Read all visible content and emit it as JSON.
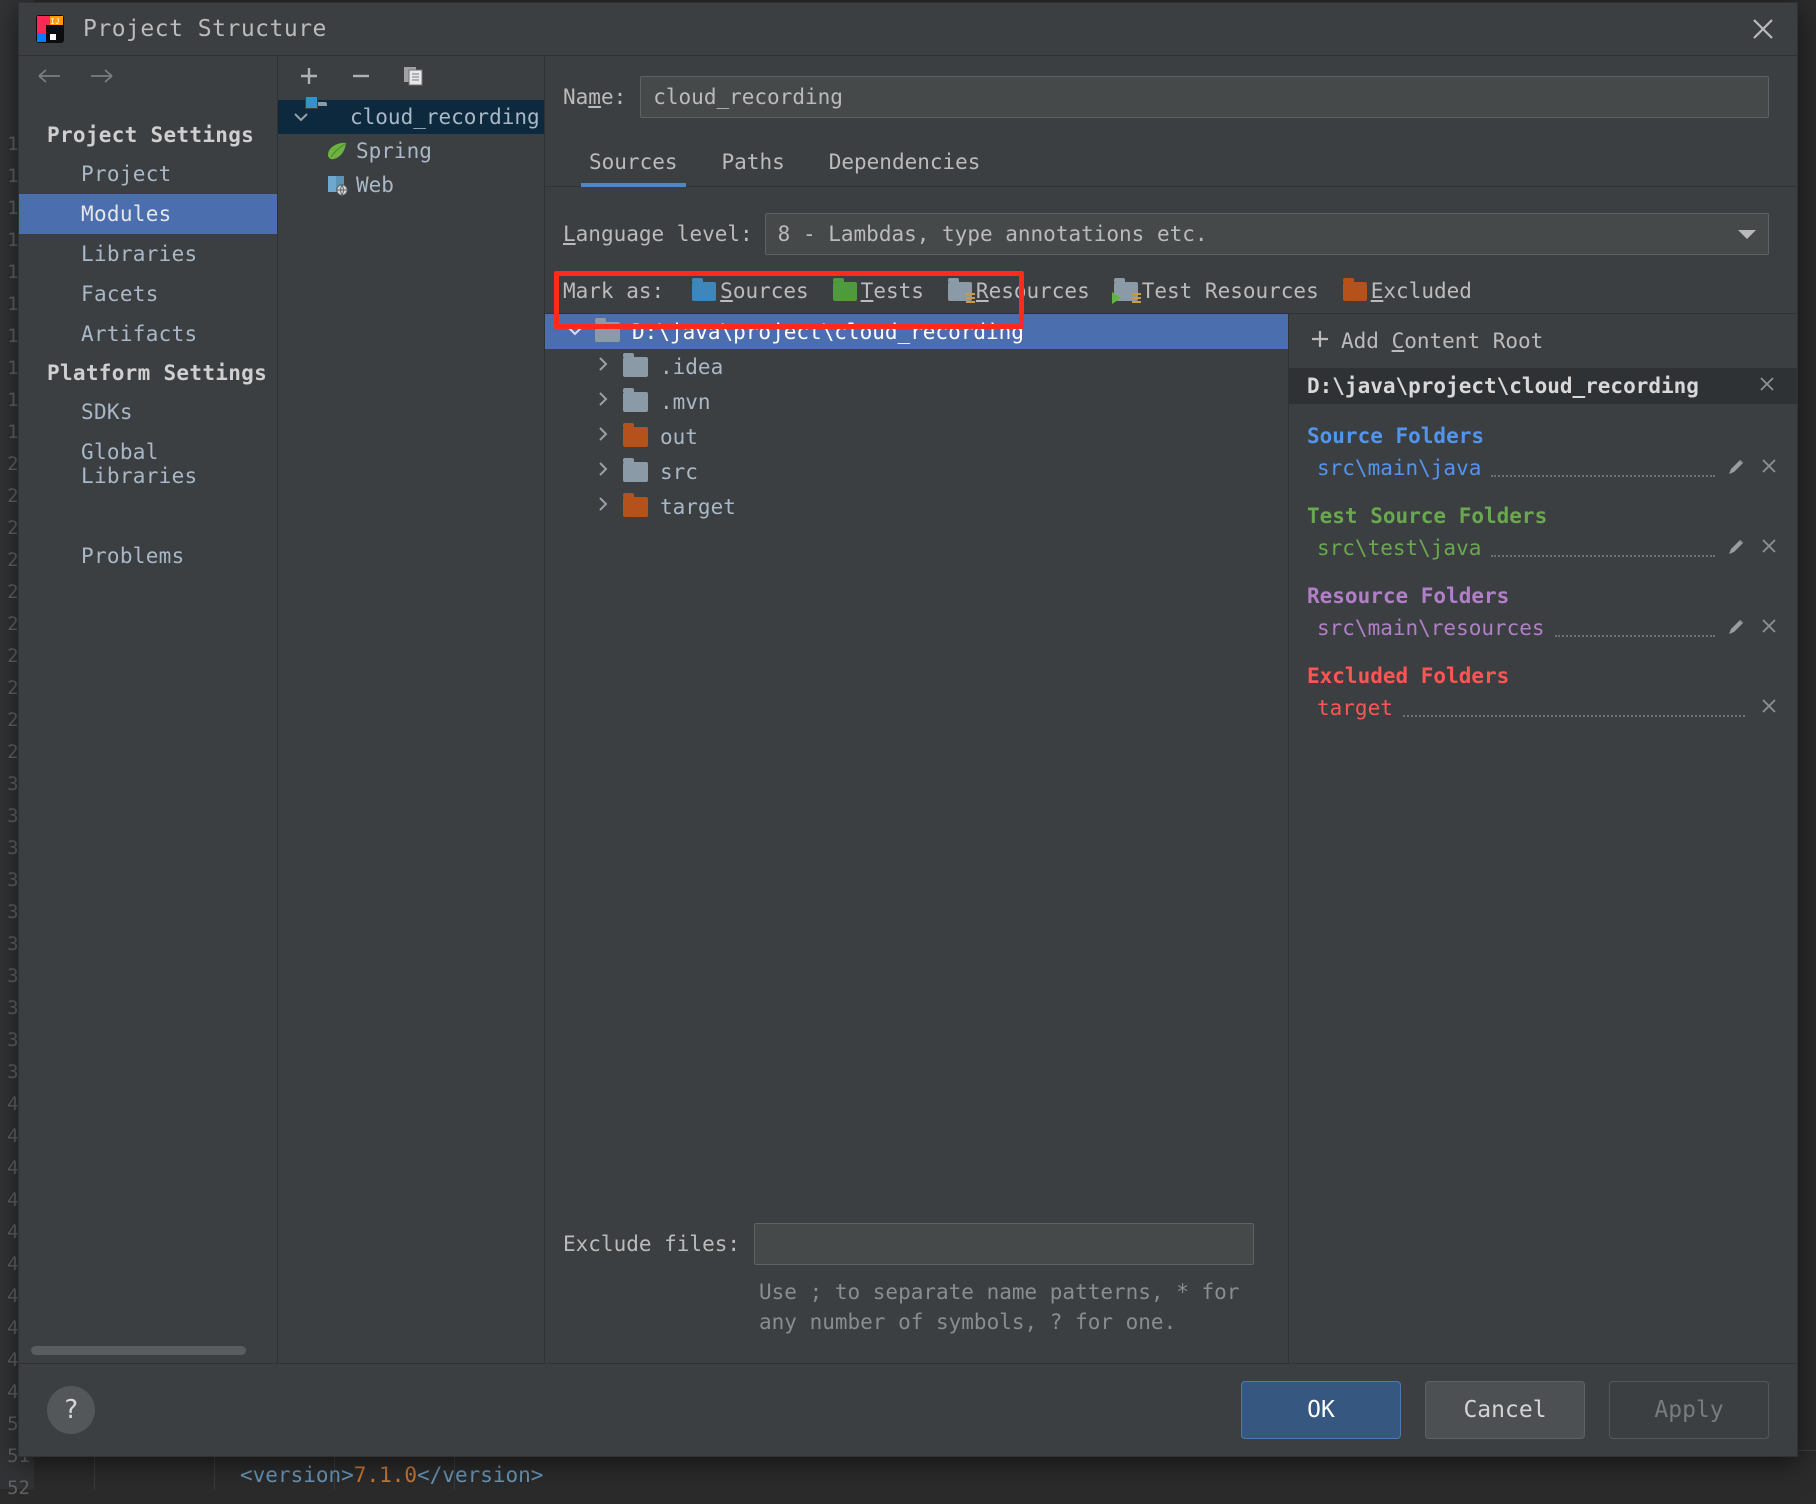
{
  "window": {
    "title": "Project Structure",
    "logo_icon": "intellij-idea-logo",
    "close_icon": "close-icon"
  },
  "nav": {
    "back_icon": "arrow-left-icon",
    "forward_icon": "arrow-right-icon"
  },
  "sidebar": {
    "groups": [
      {
        "header": "Project Settings",
        "items": [
          {
            "label": "Project",
            "selected": false
          },
          {
            "label": "Modules",
            "selected": true
          },
          {
            "label": "Libraries",
            "selected": false
          },
          {
            "label": "Facets",
            "selected": false
          },
          {
            "label": "Artifacts",
            "selected": false
          }
        ]
      },
      {
        "header": "Platform Settings",
        "items": [
          {
            "label": "SDKs",
            "selected": false
          },
          {
            "label": "Global Libraries",
            "selected": false
          }
        ]
      }
    ],
    "problems_label": "Problems"
  },
  "modules_panel": {
    "toolbar": {
      "add_icon": "plus-icon",
      "remove_icon": "minus-icon",
      "copy_icon": "copy-icon",
      "add_label": "+",
      "remove_label": "−"
    },
    "tree": [
      {
        "label": "cloud_recording",
        "icon": "module-folder-icon",
        "selected": true,
        "expanded": true,
        "level": 0
      },
      {
        "label": "Spring",
        "icon": "spring-leaf-icon",
        "selected": false,
        "level": 1
      },
      {
        "label": "Web",
        "icon": "web-facet-icon",
        "selected": false,
        "level": 1
      }
    ]
  },
  "main": {
    "name_label": "Name:",
    "name_value": "cloud_recording",
    "tabs": [
      {
        "label": "Sources",
        "active": true
      },
      {
        "label": "Paths",
        "active": false
      },
      {
        "label": "Dependencies",
        "active": false
      }
    ],
    "language_level_label": "Language level:",
    "language_level_value": "8 - Lambdas, type annotations etc.",
    "language_level_caret_icon": "chevron-down-icon",
    "mark_as_label": "Mark as:",
    "mark_as_options": [
      {
        "label": "Sources",
        "color": "#3d87bd",
        "badge": "none"
      },
      {
        "label": "Tests",
        "color": "#4e9a3d",
        "badge": "none"
      },
      {
        "label": "Resources",
        "color": "#8b9aa7",
        "badge": "lines"
      },
      {
        "label": "Test Resources",
        "color": "#8b9aa7",
        "badge": "lines-green"
      },
      {
        "label": "Excluded",
        "color": "#b5521c",
        "badge": "none"
      }
    ],
    "folder_tree": [
      {
        "label": "D:\\java\\project\\cloud_recording",
        "color": "#8b9aa7",
        "selected": true,
        "expanded": true,
        "level": 0
      },
      {
        "label": ".idea",
        "color": "#8b9aa7",
        "selected": false,
        "level": 1
      },
      {
        "label": ".mvn",
        "color": "#8b9aa7",
        "selected": false,
        "level": 1
      },
      {
        "label": "out",
        "color": "#b5521c",
        "selected": false,
        "level": 1
      },
      {
        "label": "src",
        "color": "#8b9aa7",
        "selected": false,
        "level": 1
      },
      {
        "label": "target",
        "color": "#b5521c",
        "selected": false,
        "level": 1
      }
    ],
    "exclude_files_label": "Exclude files:",
    "exclude_files_value": "",
    "exclude_hint": "Use ; to separate name patterns, * for\nany number of symbols, ? for one."
  },
  "roots_panel": {
    "add_content_root_label": "Add Content Root",
    "add_icon": "plus-icon",
    "content_root_path": "D:\\java\\project\\cloud_recording",
    "content_root_remove_icon": "close-icon",
    "groups": [
      {
        "title": "Source Folders",
        "color": "#5394ec",
        "entries": [
          {
            "path": "src\\main\\java",
            "edit_icon": "pencil-icon",
            "remove_icon": "close-icon"
          }
        ]
      },
      {
        "title": "Test Source Folders",
        "color": "#6aa84f",
        "entries": [
          {
            "path": "src\\test\\java",
            "edit_icon": "pencil-icon",
            "remove_icon": "close-icon"
          }
        ]
      },
      {
        "title": "Resource Folders",
        "color": "#b07fc7",
        "entries": [
          {
            "path": "src\\main\\resources",
            "edit_icon": "pencil-icon",
            "remove_icon": "close-icon"
          }
        ]
      },
      {
        "title": "Excluded Folders",
        "color": "#ff5555",
        "entries": [
          {
            "path": "target",
            "edit_icon": null,
            "remove_icon": "close-icon"
          }
        ]
      }
    ]
  },
  "footer": {
    "help_label": "?",
    "ok_label": "OK",
    "cancel_label": "Cancel",
    "apply_label": "Apply"
  },
  "editor_background": {
    "code_line": "<version>7.1.0</version>",
    "code_tag_open": "<version>",
    "code_value": "7.1.0",
    "code_tag_close": "</version>"
  },
  "annotation": {
    "type": "red-rectangle-highlight",
    "color": "#ff2a1c",
    "targets": "selected content root row"
  }
}
